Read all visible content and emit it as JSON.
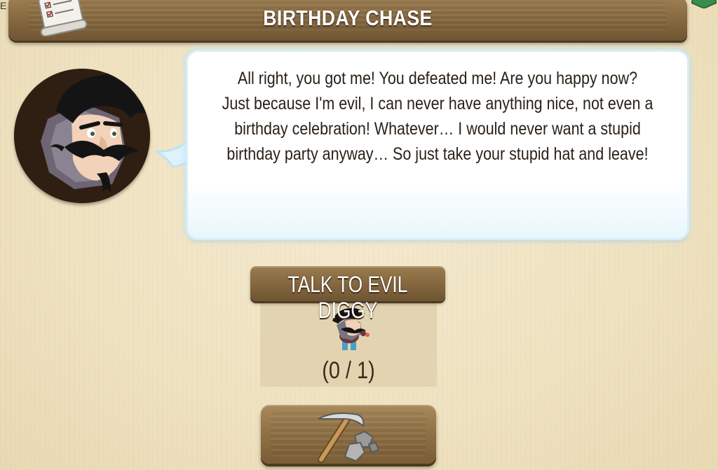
{
  "header": {
    "title": "BIRTHDAY CHASE",
    "edge_mark": "E"
  },
  "dialog": {
    "speaker_icon": "evil-diggy-portrait",
    "lines": [
      "All right, you got me! You defeated me! Are you happy now?",
      "Just because I'm evil, I can never have anything nice, not even a",
      "birthday celebration! Whatever… I would never want a stupid",
      "birthday party anyway… So just take your stupid hat and leave!"
    ]
  },
  "task": {
    "label": "TALK TO EVIL DIGGY",
    "icon": "evil-diggy-figure",
    "progress_text": "(0 / 1)",
    "progress": {
      "current": 0,
      "total": 1
    }
  },
  "action": {
    "icon": "pickaxe-icon"
  },
  "colors": {
    "wood": "#8a6c42",
    "parchment": "#efe3c2",
    "bubble_glow": "#bfe3f3",
    "text_dark": "#2a2118"
  }
}
